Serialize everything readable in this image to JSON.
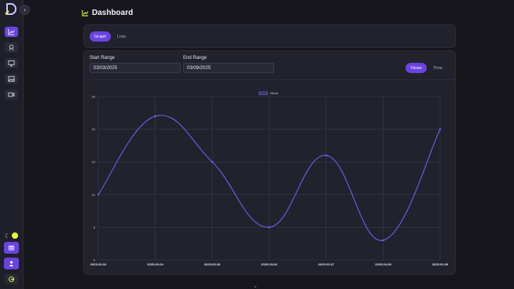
{
  "page": {
    "title": "Dashboard"
  },
  "sidebar": {
    "items": [
      {
        "name": "chart-icon"
      },
      {
        "name": "award-icon"
      },
      {
        "name": "monitor-icon"
      },
      {
        "name": "image-icon"
      },
      {
        "name": "video-icon"
      }
    ]
  },
  "tabs": [
    {
      "label": "Graph",
      "active": true
    },
    {
      "label": "Lists",
      "active": false
    }
  ],
  "filters": {
    "start_label": "Start Range",
    "start_value": "03/03/2025",
    "end_label": "End Range",
    "end_value": "03/09/2025"
  },
  "toggle": [
    {
      "label": "Views",
      "active": true
    },
    {
      "label": "Time",
      "active": false
    }
  ],
  "colors": {
    "accent": "#6a43e0",
    "line": "#6f66ff"
  },
  "chart_data": {
    "type": "line",
    "categories": [
      "2025-03-03",
      "2025-03-04",
      "2025-03-05",
      "2025-03-06",
      "2025-03-07",
      "2025-03-08",
      "2025-03-09"
    ],
    "series": [
      {
        "name": "Views",
        "values": [
          10,
          22,
          15,
          5,
          16,
          3,
          20
        ]
      }
    ],
    "ylim": [
      0,
      25
    ],
    "yticks": [
      0,
      5,
      10,
      15,
      20,
      25
    ],
    "grid": true,
    "legend": "top-center"
  }
}
